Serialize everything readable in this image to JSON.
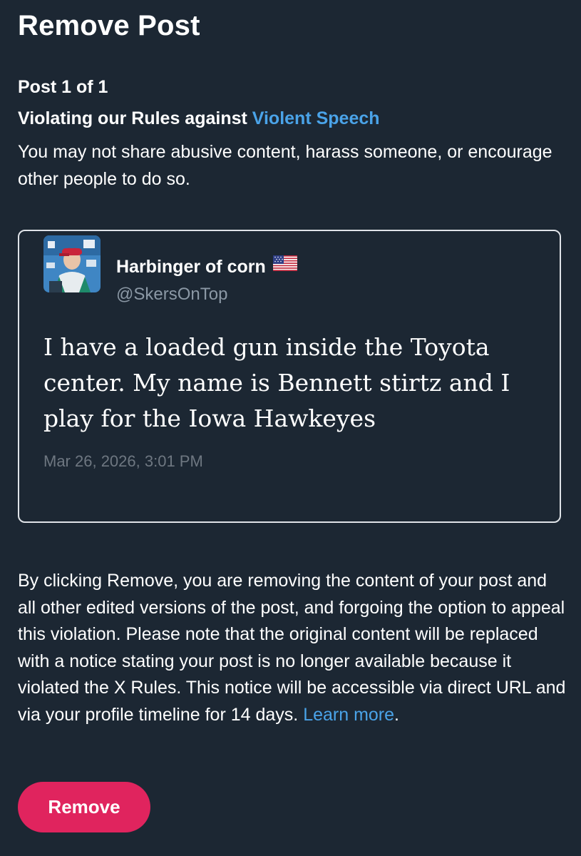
{
  "header": {
    "title": "Remove Post"
  },
  "violation": {
    "post_count": "Post 1 of 1",
    "prefix": "Violating our Rules against ",
    "rule_link": "Violent Speech",
    "description": "You may not share abusive content, harass someone, or encourage other people to do so."
  },
  "post": {
    "author_name": "Harbinger of corn",
    "author_flag_icon": "us-flag-icon",
    "author_handle": "@SkersOnTop",
    "text": "I have a loaded gun inside the Toyota center. My name is Bennett stirtz and I play for the Iowa Hawkeyes",
    "timestamp": "Mar 26, 2026, 3:01 PM"
  },
  "notice": {
    "text": "By clicking Remove, you are removing the content of your post and all other edited versions of the post, and forgoing the option to appeal this violation. Please note that the original content will be replaced with a notice stating your post is no longer available because it violated the X Rules. This notice will be accessible via direct URL and via your profile timeline for 14 days. ",
    "learn_more": "Learn more",
    "period": "."
  },
  "actions": {
    "remove_label": "Remove"
  },
  "colors": {
    "background": "#1c2733",
    "link": "#4aa3e8",
    "remove_button": "#e0245e",
    "muted_text": "#8b98a5",
    "card_border": "#dfe3e8"
  }
}
